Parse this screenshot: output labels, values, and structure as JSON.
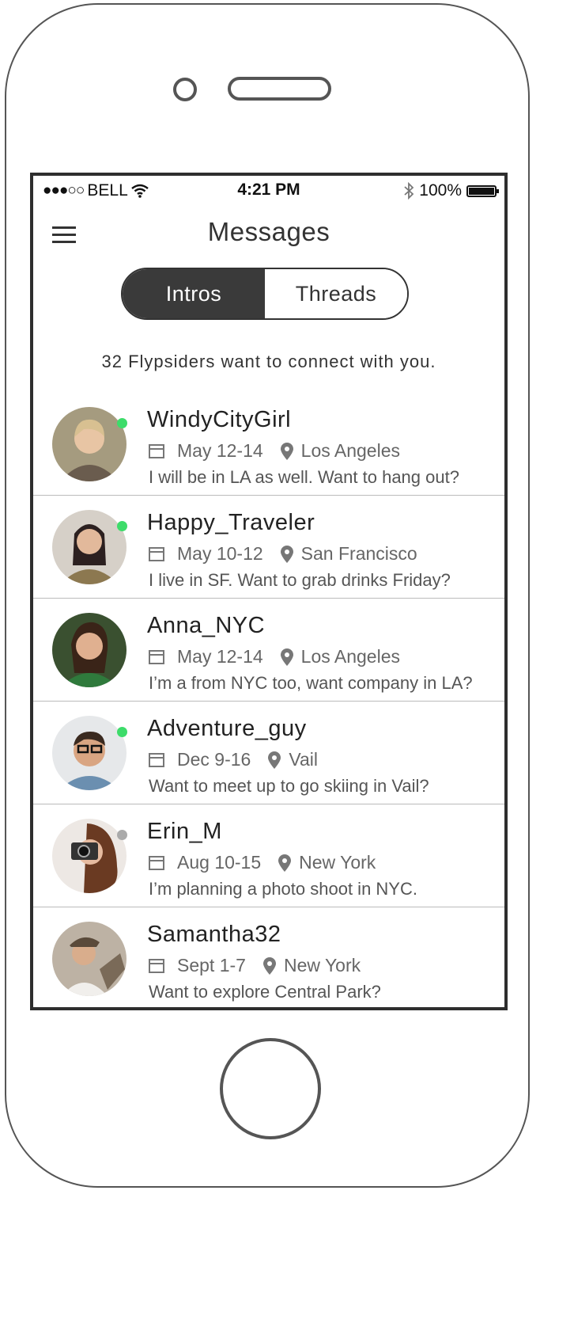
{
  "status_bar": {
    "carrier": "BELL",
    "time": "4:21 PM",
    "battery": "100%"
  },
  "header": {
    "title": "Messages"
  },
  "tabs": [
    {
      "label": "Intros",
      "active": true
    },
    {
      "label": "Threads",
      "active": false
    }
  ],
  "notice": "32 Flypsiders want to connect with you.",
  "colors": {
    "online": "#3ddc6a",
    "offline": "#aaaaaa",
    "active_tab": "#3a3a3a"
  },
  "contacts": [
    {
      "name": "WindyCityGirl",
      "dates": "May 12-14",
      "location": "Los Angeles",
      "message": "I will be in LA as well. Want to hang out?",
      "online": true
    },
    {
      "name": "Happy_Traveler",
      "dates": "May 10-12",
      "location": "San Francisco",
      "message": "I live in SF. Want to grab drinks Friday?",
      "online": true
    },
    {
      "name": "Anna_NYC",
      "dates": "May 12-14",
      "location": "Los Angeles",
      "message": "I’m a from NYC too, want company in LA?",
      "online": null
    },
    {
      "name": "Adventure_guy",
      "dates": "Dec 9-16",
      "location": "Vail",
      "message": "Want to meet up to go skiing in Vail?",
      "online": true
    },
    {
      "name": "Erin_M",
      "dates": "Aug 10-15",
      "location": "New York",
      "message": "I’m planning a photo shoot in NYC.",
      "online": false
    },
    {
      "name": "Samantha32",
      "dates": "Sept 1-7",
      "location": "New York",
      "message": "Want to explore Central Park?",
      "online": null
    }
  ]
}
